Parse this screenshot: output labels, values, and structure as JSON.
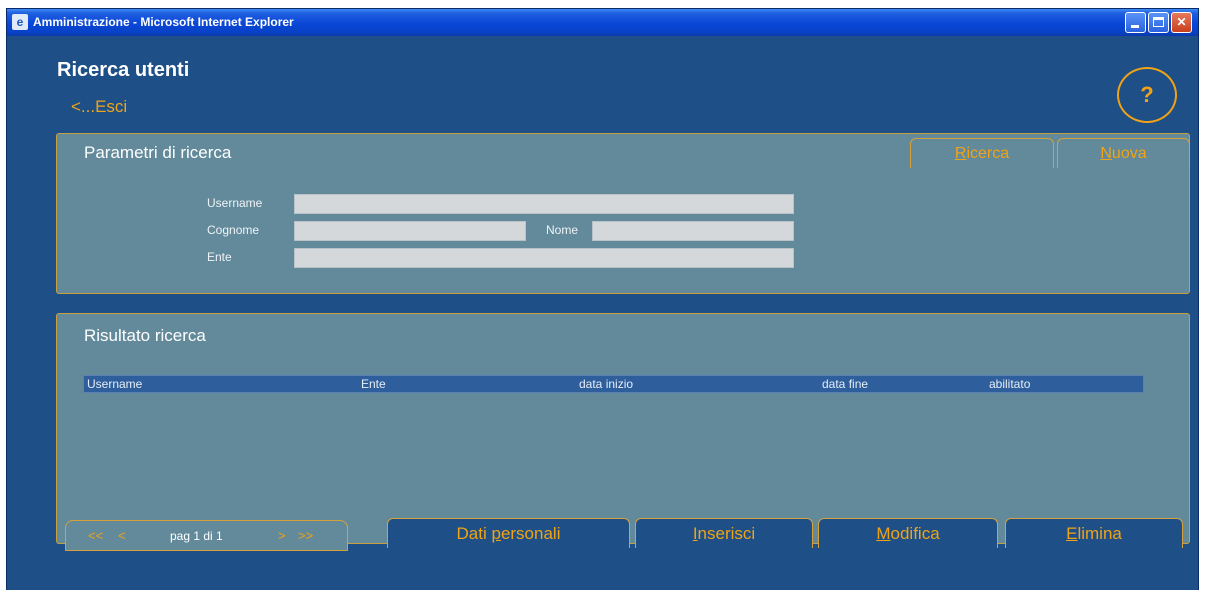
{
  "window": {
    "title": "Amministrazione - Microsoft Internet Explorer",
    "controls": {
      "minimize": "minimize-icon",
      "maximize": "maximize-icon",
      "close": "close-icon"
    }
  },
  "header": {
    "title": "Ricerca utenti",
    "back_link": "<...Esci",
    "help_label": "?"
  },
  "search_panel": {
    "title": "Parametri di ricerca",
    "tabs": [
      {
        "label_first": "R",
        "label_rest": "icerca"
      },
      {
        "label_first": "N",
        "label_rest": "uova"
      }
    ],
    "fields": {
      "username_label": "Username",
      "cognome_label": "Cognome",
      "nome_label": "Nome",
      "ente_label": "Ente",
      "username_value": "",
      "cognome_value": "",
      "nome_value": "",
      "ente_value": ""
    }
  },
  "results_panel": {
    "title": "Risultato ricerca",
    "columns": [
      "Username",
      "Ente",
      "data inizio",
      "data fine",
      "abilitato"
    ],
    "rows": []
  },
  "pager": {
    "first": "<<",
    "prev": "<",
    "info": "pag 1 di 1",
    "next": ">",
    "last": ">>"
  },
  "actions": [
    {
      "first": "Dati ",
      "ul": "p",
      "rest": "ersonali"
    },
    {
      "first": "",
      "ul": "I",
      "rest": "nserisci"
    },
    {
      "first": "",
      "ul": "M",
      "rest": "odifica"
    },
    {
      "first": "",
      "ul": "E",
      "rest": "limina"
    }
  ],
  "colors": {
    "window_bg": "#1e4f86",
    "panel_bg": "#628a9b",
    "accent": "#f0a316",
    "titlebar": "#0a46d6"
  }
}
